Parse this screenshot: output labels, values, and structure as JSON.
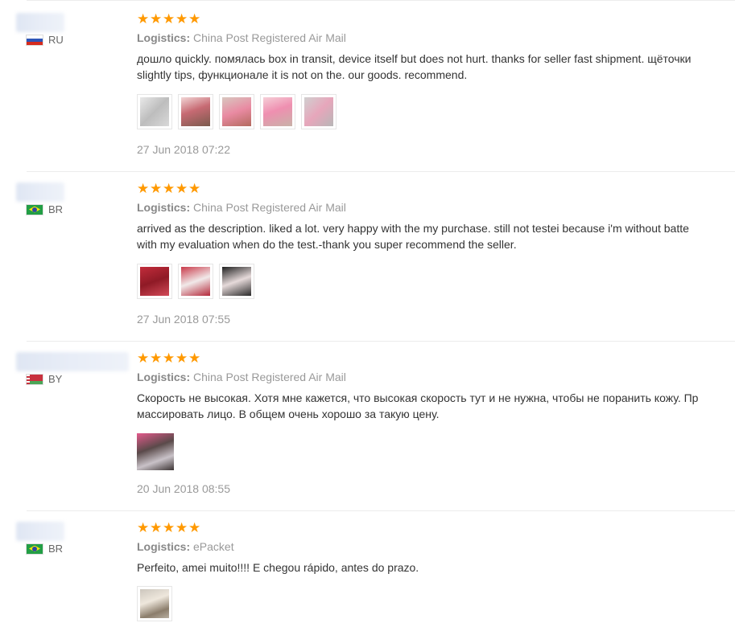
{
  "logistics_label": "Logistics:",
  "reviews": [
    {
      "country": "RU",
      "flag": "flag-ru-icon",
      "rating": 5,
      "logistics": "China Post Registered Air Mail",
      "comment_lines": [
        "дошло quickly. помялась box in transit, device itself but does not hurt. thanks for seller fast shipment. щёточки",
        "slightly tips, функционале it is not on the. our goods. recommend."
      ],
      "images": [
        "product-photo-1",
        "product-photo-2",
        "product-photo-3",
        "product-photo-4",
        "product-photo-5"
      ],
      "date": "27 Jun 2018 07:22"
    },
    {
      "country": "BR",
      "flag": "flag-br-icon",
      "rating": 5,
      "logistics": "China Post Registered Air Mail",
      "comment_lines": [
        "arrived as the description. liked a lot. very happy with the my purchase. still not testei because i'm without batte",
        "with my evaluation when do the test.-thank you super recommend the seller."
      ],
      "images": [
        "product-photo-1",
        "product-photo-2",
        "product-photo-3"
      ],
      "date": "27 Jun 2018 07:55"
    },
    {
      "country": "BY",
      "flag": "flag-by-icon",
      "rating": 5,
      "logistics": "China Post Registered Air Mail",
      "comment_lines": [
        "Скорость не высокая. Хотя мне кажется, что высокая скорость тут и не нужна, чтобы не поранить кожу. Пр",
        "массировать лицо. В общем очень хорошо за такую цену."
      ],
      "images": [
        "product-photo-1"
      ],
      "date": "20 Jun 2018 08:55"
    },
    {
      "country": "BR",
      "flag": "flag-br-icon",
      "rating": 5,
      "logistics": "ePacket",
      "comment_lines": [
        "Perfeito, amei muito!!!! E chegou rápido, antes do prazo."
      ],
      "images": [
        "product-photo-1"
      ],
      "date": ""
    }
  ],
  "colors": {
    "star": "#ff9900",
    "meta_text": "#999999",
    "body_text": "#333333"
  }
}
